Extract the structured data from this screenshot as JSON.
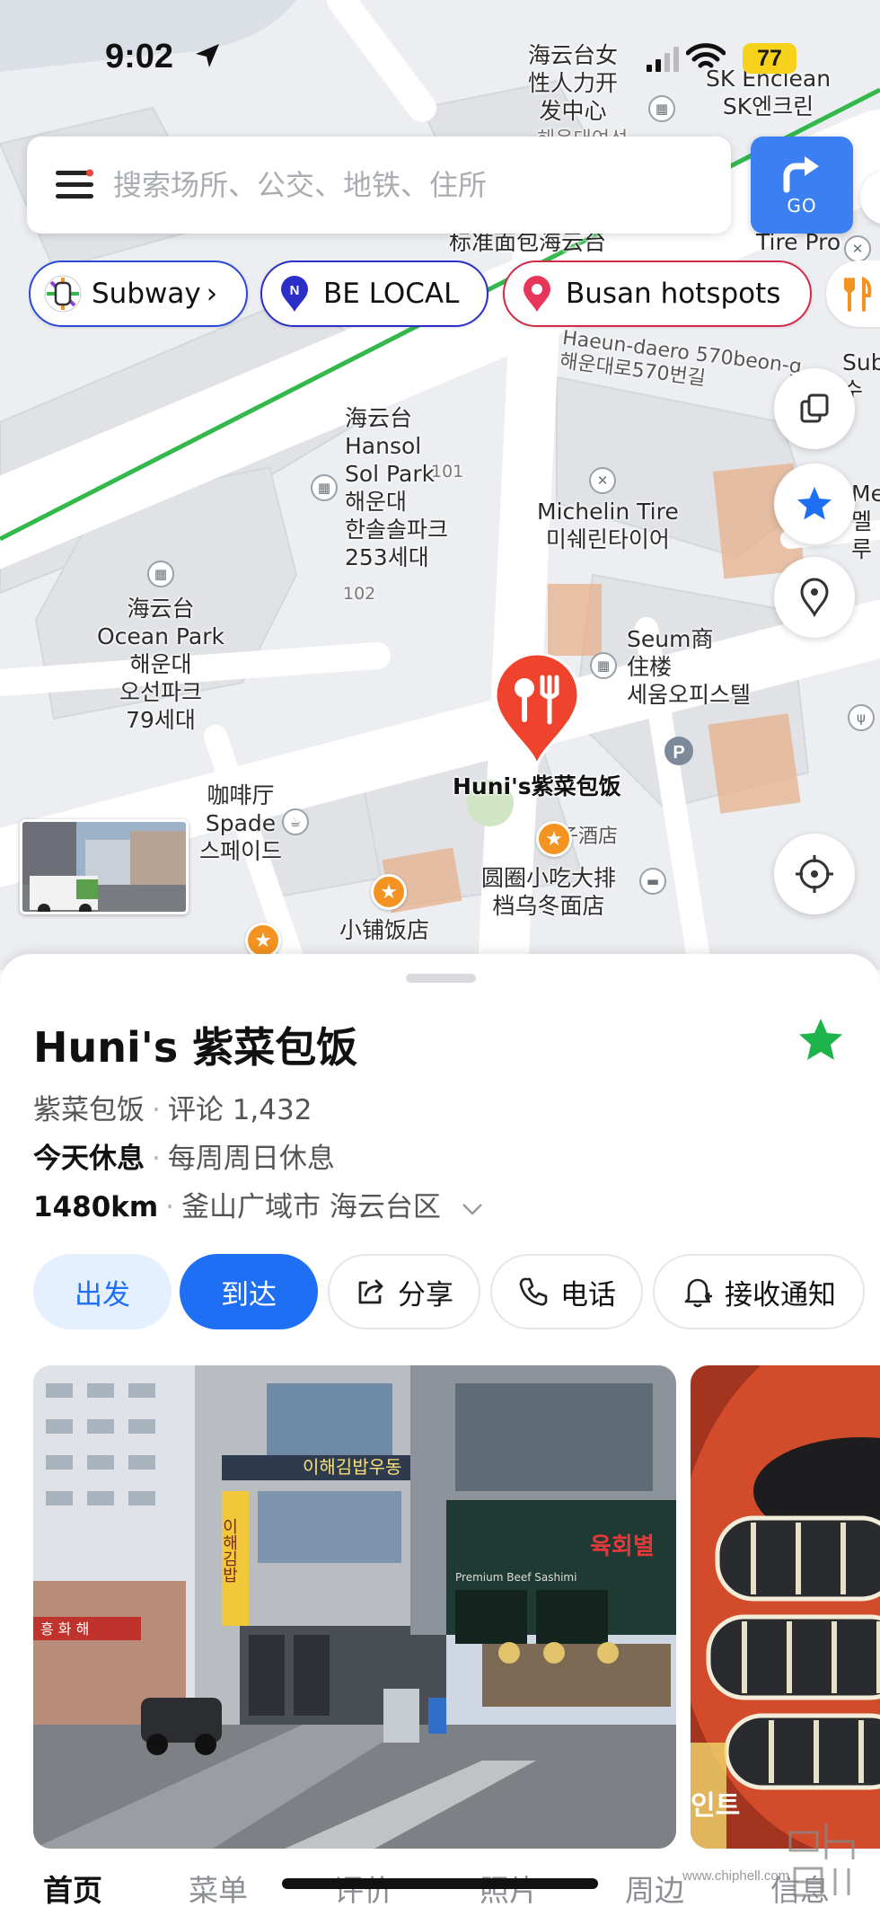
{
  "status_bar": {
    "time": "9:02",
    "battery": "77"
  },
  "search": {
    "placeholder": "搜索场所、公交、地铁、住所",
    "go_label": "GO"
  },
  "chips": [
    {
      "label": "Subway",
      "suffix": "›"
    },
    {
      "label": "BE LOCAL"
    },
    {
      "label": "Busan hotspots"
    }
  ],
  "map": {
    "labels": {
      "hr_center": "海云台女\n性人力开\n发中心",
      "hr_center_kr": "해운대여성",
      "sk_enclean": "SK Enclean\nSK엔크린",
      "bread": "标准面包海云台",
      "tire_pro": "Tire Pro",
      "road": "Haeun-daero 570beon-g\n해운대로570번길",
      "sub_edge": "Sub\n수",
      "me_edge": "Me\n멜루",
      "hansol": "海云台\nHansol\nSol Park\n해운대\n한솔솔파크\n253세대",
      "hansol_101": "101",
      "hansol_102": "102",
      "michelin": "Michelin Tire\n미쉐린타이어",
      "ocean_park": "海云台\nOcean Park\n해운대\n오선파크\n79세대",
      "seum": "Seum商\n住楼\n세움오피스텔",
      "cafe": "咖啡厅\nSpade\n스페이드",
      "huni": "Huni's紫菜包饭",
      "circle": "圆圈小吃大排\n档乌冬面店",
      "pub": "揽子酒店",
      "small_shop": "小铺饭店"
    }
  },
  "place": {
    "name": "Huni's 紫菜包饭",
    "category": "紫菜包饭",
    "reviews": "评论 1,432",
    "closed_today": "今天休息",
    "closed_note": "每周周日休息",
    "distance": "1480km",
    "address": "釜山广域市 海云台区"
  },
  "actions": {
    "depart": "出发",
    "arrive": "到达",
    "share": "分享",
    "call": "电话",
    "notify": "接收通知"
  },
  "photos": {
    "sign_main": "이해김밥우동",
    "sign_vertical": "이해김밥",
    "sign_right": "육회별",
    "sign_beef": "Premium Beef Sashimi",
    "sign_left": "흥 화 해",
    "second_caption": "인트"
  },
  "tabs": [
    "首页",
    "菜单",
    "评价",
    "照片",
    "周边",
    "信息"
  ],
  "watermark": {
    "url": "www.chiphell.com"
  },
  "colors": {
    "accent_blue": "#1f6ff5",
    "go_blue": "#3b7ff3",
    "marker_red": "#f0432d",
    "fav_green": "#1eb44c",
    "route_green": "#32b84b",
    "poi_orange": "#f39321"
  }
}
